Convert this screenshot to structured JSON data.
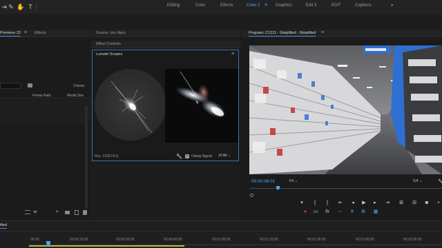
{
  "workspaces": [
    "Editing",
    "Color",
    "Effects",
    "Color 2",
    "Graphics",
    "Edit 3",
    "EDIT",
    "Captions"
  ],
  "workspace_active": "Color 2",
  "workspace_more": "»",
  "project": {
    "tab_label": "Premiere 22",
    "effects_tab": "Effects",
    "items_count": "3 items",
    "col_frame_rate": "Frame Rate",
    "col_media_start": "Media Star"
  },
  "source": {
    "tab_label": "Source: (no clips)",
    "effect_controls_tab": "Effect Controls"
  },
  "lumetri": {
    "title": "Lumetri Scopes",
    "space": "Rec. 2100 HLG",
    "clamp_label": "Clamp Signal",
    "bit_depth": "10 Bit",
    "clamp_checked": true
  },
  "program": {
    "tab_label": "Program: C1211 - Simplified - Simplified",
    "timecode": "00:00:06:01",
    "fit": "Fit",
    "resolution": "1/4"
  },
  "timeline": {
    "sequence_label": "ified",
    "timecode_left": "00:00",
    "ruler": [
      "00:00",
      "00:00:15:00",
      "00:00:30:00",
      "00:00:45:00",
      "00:01:00:00",
      "00:01:15:00",
      "00:01:30:00",
      "00:01:45:00",
      "00:02:00:00"
    ],
    "playhead_fraction": 0.047
  },
  "colors": {
    "accent": "#4ea7ff",
    "panel": "#1b1b1b",
    "bar": "#232323",
    "highlight": "#3f6fb0"
  }
}
